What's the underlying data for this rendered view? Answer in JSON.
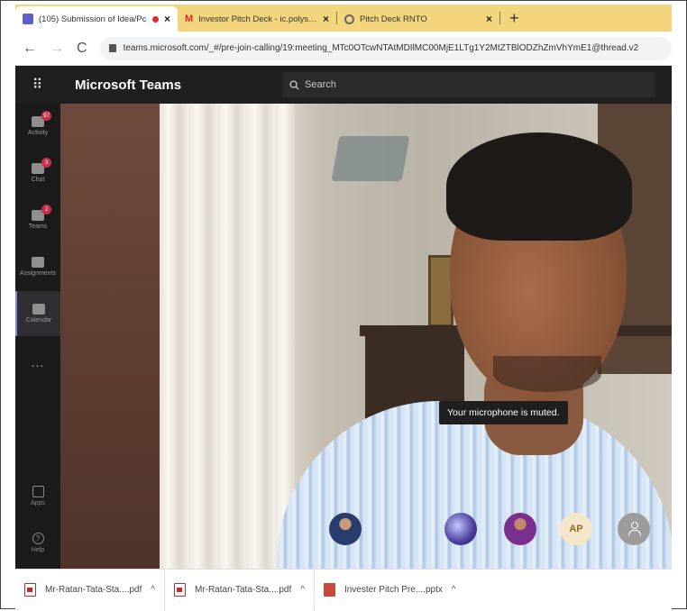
{
  "browser": {
    "tabs": [
      {
        "title": "(105) Submission of Idea/Pc",
        "favicon": "teams-icon",
        "recording": true,
        "close": "×"
      },
      {
        "title": "Investor Pitch Deck - ic.polysgn",
        "favicon": "gmail-icon",
        "close": "×"
      },
      {
        "title": "Pitch Deck RNTO",
        "favicon": "polygon-icon",
        "close": "×"
      }
    ],
    "new_tab": "+",
    "nav": {
      "back": "←",
      "forward": "→",
      "reload": "C"
    },
    "url": "teams.microsoft.com/_#/pre-join-calling/19:meeting_MTc0OTcwNTAtMDIlMC00MjE1LTg1Y2MtZTBlODZhZmVhYmE1@thread.v2"
  },
  "teams": {
    "app_title": "Microsoft Teams",
    "launcher": "⠿",
    "search_placeholder": "Search",
    "rail": [
      {
        "label": "Activity",
        "badge": "97"
      },
      {
        "label": "Chat",
        "badge": "3"
      },
      {
        "label": "Teams",
        "badge": "2"
      },
      {
        "label": "Assignments",
        "badge": ""
      },
      {
        "label": "Calendar",
        "badge": "",
        "active": true
      }
    ],
    "more": "...",
    "rail_bottom": [
      {
        "label": "Apps"
      },
      {
        "label": "Help"
      }
    ]
  },
  "meeting": {
    "toast": "Your microphone is muted.",
    "participants": [
      {
        "name": "participant-1"
      },
      {
        "name": "participant-2"
      },
      {
        "name": "participant-3"
      },
      {
        "initials": "AP"
      },
      {
        "name": "participant-5"
      }
    ]
  },
  "downloads": [
    {
      "name": "Mr-Ratan-Tata-Sta....pdf",
      "type": "pdf"
    },
    {
      "name": "Mr-Ratan-Tata-Sta....pdf",
      "type": "pdf"
    },
    {
      "name": "Invester Pitch Pre....pptx",
      "type": "pptx"
    }
  ],
  "download_caret": "^"
}
